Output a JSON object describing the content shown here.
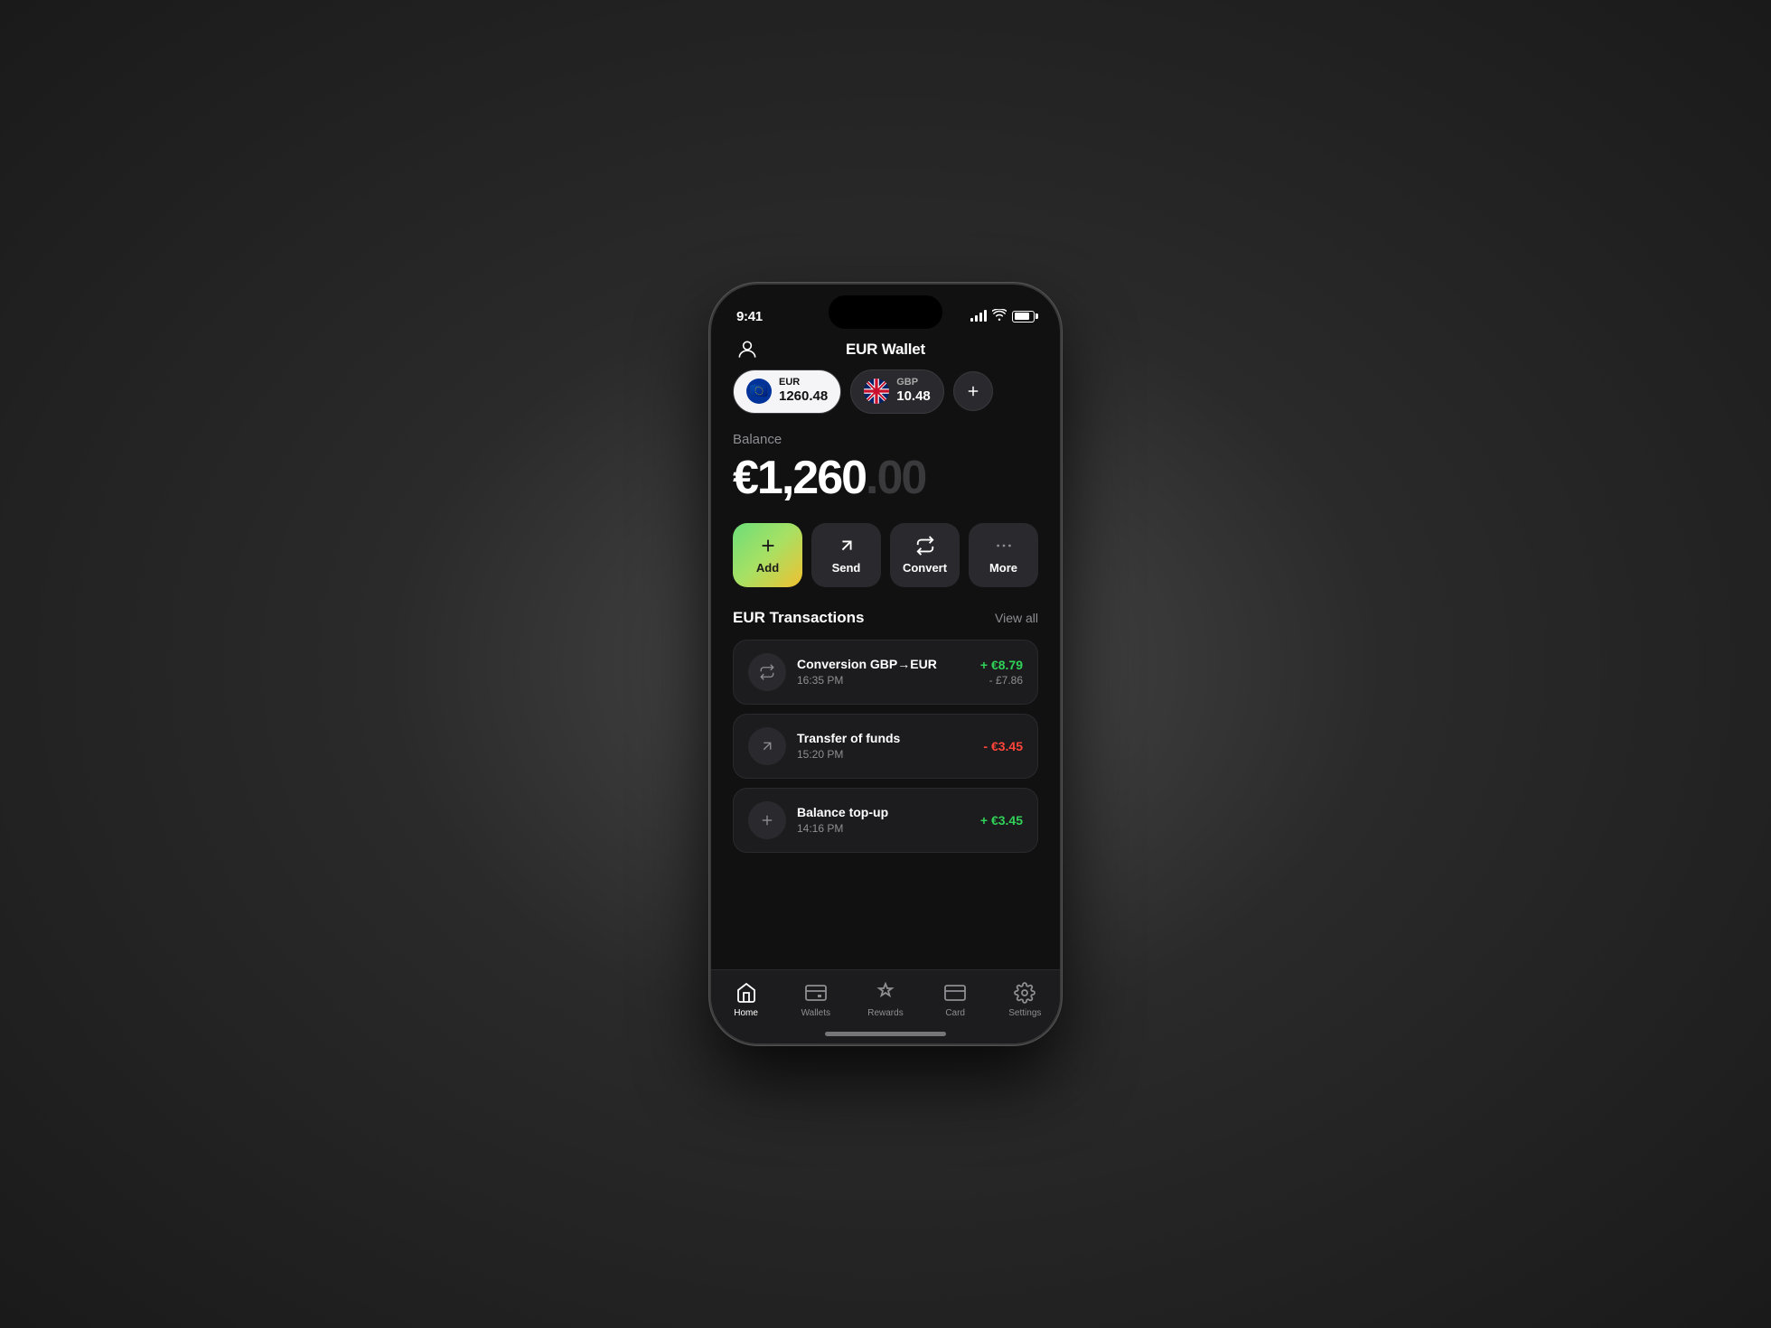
{
  "status": {
    "time": "9:41",
    "battery_pct": 80
  },
  "header": {
    "title": "EUR Wallet"
  },
  "currencies": [
    {
      "code": "EUR",
      "amount": "1260.48",
      "active": true
    },
    {
      "code": "GBP",
      "amount": "10.48",
      "active": false
    }
  ],
  "balance": {
    "label": "Balance",
    "whole": "€1,260",
    "cents": ".00"
  },
  "actions": [
    {
      "id": "add",
      "label": "Add"
    },
    {
      "id": "send",
      "label": "Send"
    },
    {
      "id": "convert",
      "label": "Convert"
    },
    {
      "id": "more",
      "label": "More"
    }
  ],
  "transactions": {
    "title": "EUR Transactions",
    "view_all_label": "View all",
    "items": [
      {
        "name": "Conversion GBP→EUR",
        "time": "16:35 PM",
        "amount_primary": "+ €8.79",
        "amount_primary_type": "positive",
        "amount_secondary": "- £7.86",
        "icon": "convert"
      },
      {
        "name": "Transfer of funds",
        "time": "15:20 PM",
        "amount_primary": "- €3.45",
        "amount_primary_type": "negative",
        "amount_secondary": null,
        "icon": "send"
      },
      {
        "name": "Balance top-up",
        "time": "14:16 PM",
        "amount_primary": "+ €3.45",
        "amount_primary_type": "positive",
        "amount_secondary": null,
        "icon": "add"
      }
    ]
  },
  "nav": {
    "items": [
      {
        "id": "home",
        "label": "Home",
        "active": true
      },
      {
        "id": "wallets",
        "label": "Wallets",
        "active": false
      },
      {
        "id": "rewards",
        "label": "Rewards",
        "active": false
      },
      {
        "id": "card",
        "label": "Card",
        "active": false
      },
      {
        "id": "settings",
        "label": "Settings",
        "active": false
      }
    ]
  }
}
